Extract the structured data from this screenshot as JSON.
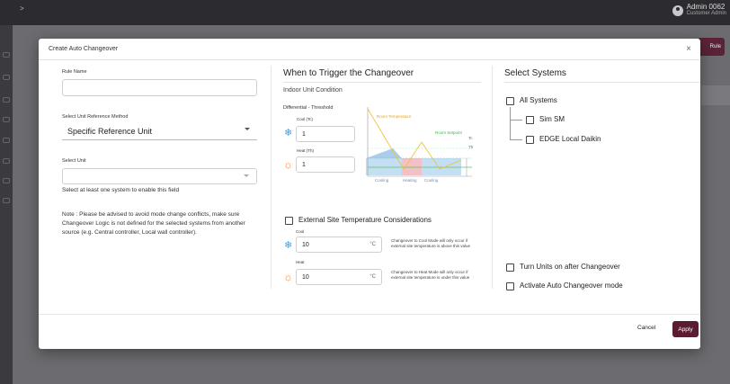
{
  "app": {
    "user_name": "Admin 0062",
    "user_role": "Customer Admin",
    "bg_rule_button": "Rule"
  },
  "modal": {
    "title": "Create Auto Changeover",
    "close": "×",
    "left": {
      "rule_name_label": "Rule Name",
      "rule_name_value": "",
      "ref_method_label": "Select Unit Reference Method",
      "ref_method_value": "Specific Reference Unit",
      "select_unit_label": "Select Unit",
      "select_unit_value": "",
      "validation": "Select at least one system to enable this field",
      "note": "Note : Please be advised to avoid mode change conflicts, make sure Changeover Logic is not defined for the selected systems from another source (e.g. Central controller, Local wall controller)."
    },
    "middle": {
      "title": "When to Trigger the Changeover",
      "subtitle": "Indoor Unit Condition",
      "diff_label": "Differential - Threshold",
      "cool_label": "Cool (Tc)",
      "cool_value": "1",
      "heat_label": "Heat (Th)",
      "heat_value": "1",
      "chart": {
        "room_temperature": "Room Temperature",
        "room_setpoint": "Room Setpoint",
        "tc": "Tc",
        "th": "Th",
        "cooling1": "Cooling",
        "heating": "Heating",
        "cooling2": "Cooling"
      },
      "ext_title": "External Site Temperature Considerations",
      "ext_checked": false,
      "ext_cool_label": "Cool",
      "ext_cool_value": "10",
      "ext_cool_unit": "°C",
      "ext_cool_desc": "Changeover to Cool Mode will only occur if external site temperature is above this value",
      "ext_heat_label": "Heat",
      "ext_heat_value": "10",
      "ext_heat_unit": "°C",
      "ext_heat_desc": "Changeover to Heat Mode will only occur if external site temperature is under this value"
    },
    "right": {
      "title": "Select Systems",
      "all_systems": "All Systems",
      "systems": [
        "Sim SM",
        "EDGE Local Daikin"
      ],
      "turn_on": "Turn Units on after Changeover",
      "activate": "Activate Auto Changeover mode"
    },
    "footer": {
      "cancel": "Cancel",
      "apply": "Apply"
    }
  },
  "colors": {
    "accent": "#5a1c33",
    "cool_icon": "#4a9ad6",
    "heat_icon": "#f08a3c",
    "room_temp_line": "#f2c23a",
    "setpoint_line": "#5cc06a"
  }
}
